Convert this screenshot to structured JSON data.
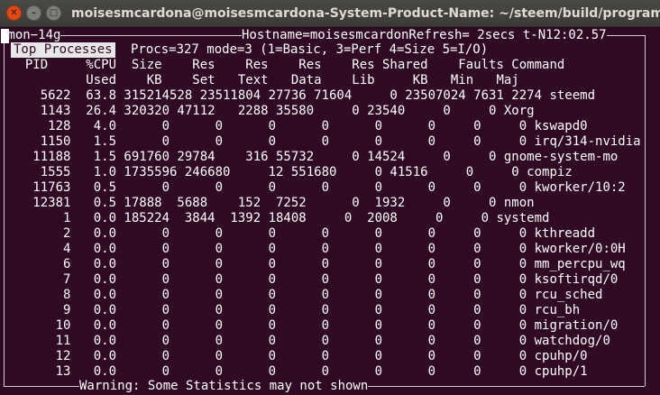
{
  "window": {
    "title": "moisesmcardona@moisesmcardona-System-Product-Name: ~/steem/build/programs/steem",
    "close_glyph": "✕",
    "min_glyph": "–",
    "max_glyph": "□"
  },
  "nmon": {
    "app_label": "nmon−14g",
    "hostname_info": "Hostname=moisesmcardonRefresh= 2secs t-N12:02.57",
    "top_processes_label": "Top Processes",
    "summary": "Procs=327 mode=3 (1=Basic, 3=Perf 4=Size 5=I/O)",
    "warning": "Warning: Some Statistics may not shown",
    "header1": "  PID     %CPU  Size    Res    Res    Res    Res Shared    Faults Command",
    "header2": "          Used    KB    Set   Text   Data    Lib     KB   Min   Maj",
    "rows": [
      "    5622  63.8 315214528 23511804 27736 71604     0 23507024 7631 2274 steemd",
      "    1143  26.4 320320 47112   2288 35580     0 23540     0     0 Xorg",
      "     128   4.0      0      0      0      0      0      0     0     0 kswapd0",
      "    1150   1.5      0      0      0      0      0      0     0     0 irq/314-nvidia",
      "   11188   1.5 691760 29784    316 55732     0 14524     0     0 gnome-system-mo",
      "    1555   1.0 1735596 246680     12 551680     0 41516     0     0 compiz",
      "   11763   0.5      0      0      0      0      0      0     0     0 kworker/10:2",
      "   12381   0.5 17888  5688    152  7252      0  1932     0     0 nmon",
      "       1   0.0 185224  3844  1392 18408     0  2008     0     0 systemd",
      "       2   0.0      0      0      0      0      0      0     0     0 kthreadd",
      "       4   0.0      0      0      0      0      0      0     0     0 kworker/0:0H",
      "       6   0.0      0      0      0      0      0      0     0     0 mm_percpu_wq",
      "       7   0.0      0      0      0      0      0      0     0     0 ksoftirqd/0",
      "       8   0.0      0      0      0      0      0      0     0     0 rcu_sched",
      "       9   0.0      0      0      0      0      0      0     0     0 rcu_bh",
      "      10   0.0      0      0      0      0      0      0     0     0 migration/0",
      "      11   0.0      0      0      0      0      0      0     0     0 watchdog/0",
      "      12   0.0      0      0      0      0      0      0     0     0 cpuhp/0",
      "      13   0.0      0      0      0      0      0      0     0     0 cpuhp/1"
    ]
  }
}
